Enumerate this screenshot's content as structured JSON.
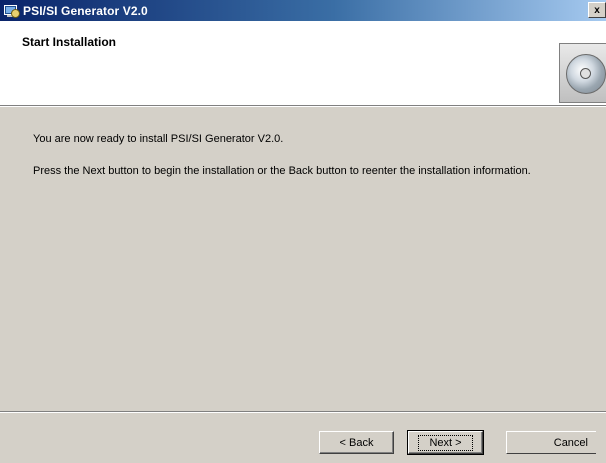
{
  "window": {
    "title": "PSI/SI Generator V2.0",
    "close_glyph": "x"
  },
  "header": {
    "title": "Start Installation",
    "icon": "cd-icon"
  },
  "body": {
    "line1": "You are now ready to install PSI/SI Generator V2.0.",
    "line2": "Press the Next button to begin the installation or the Back button to reenter the installation information."
  },
  "buttons": {
    "back": "< Back",
    "next": "Next >",
    "cancel": "Cancel"
  }
}
